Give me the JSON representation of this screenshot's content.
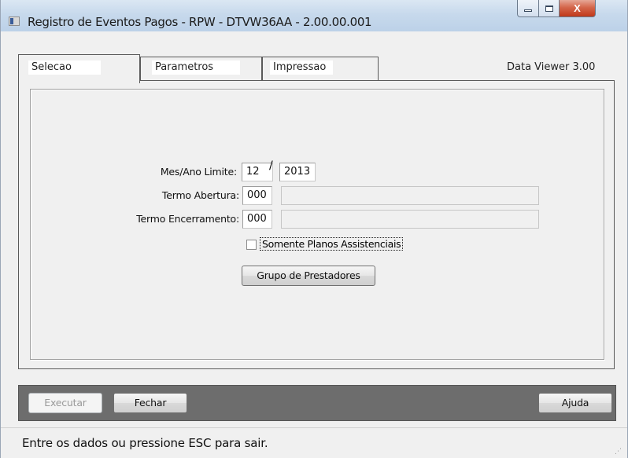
{
  "window": {
    "title": "Registro de Eventos Pagos - RPW - DTVW36AA - 2.00.00.001",
    "close_glyph": "X"
  },
  "tabs": [
    {
      "label": "Selecao",
      "active": true
    },
    {
      "label": "Parametros",
      "active": false
    },
    {
      "label": "Impressao",
      "active": false
    }
  ],
  "viewer_label": "Data Viewer 3.00",
  "form": {
    "mes_ano_label": "Mes/Ano Limite:",
    "mes_value": "12",
    "separator": "/",
    "ano_value": "2013",
    "termo_abertura_label": "Termo Abertura:",
    "termo_abertura_code": "000",
    "termo_abertura_desc": "",
    "termo_encerramento_label": "Termo Encerramento:",
    "termo_encerramento_code": "000",
    "termo_encerramento_desc": "",
    "somente_planos_label": "Somente Planos Assistenciais",
    "somente_planos_checked": false,
    "grupo_button": "Grupo de Prestadores"
  },
  "actions": {
    "executar": "Executar",
    "fechar": "Fechar",
    "ajuda": "Ajuda"
  },
  "status": "Entre os dados ou pressione ESC para sair.",
  "icons": [
    "app-icon",
    "minimize-icon",
    "maximize-icon",
    "close-icon",
    "resize-grip-icon"
  ]
}
